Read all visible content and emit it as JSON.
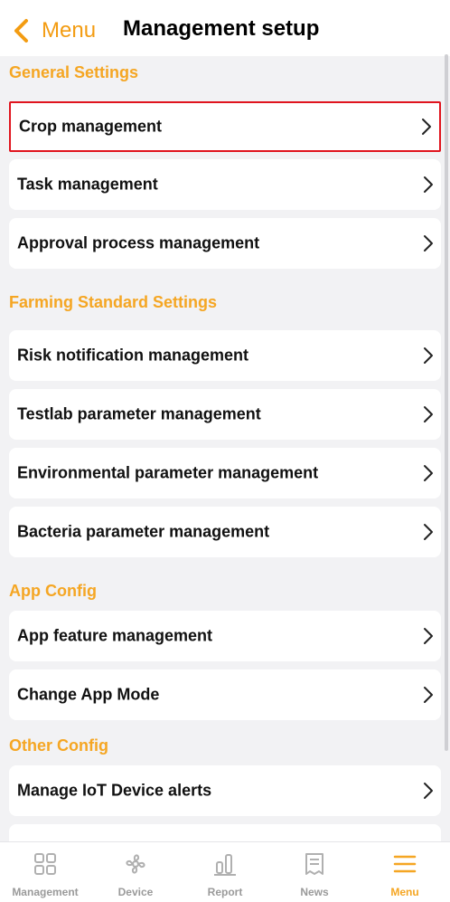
{
  "header": {
    "back_label": "Menu",
    "title": "Management setup"
  },
  "sections": {
    "general": "General Settings",
    "farming": "Farming Standard Settings",
    "app": "App Config",
    "other": "Other Config"
  },
  "items": {
    "crop": "Crop management",
    "task": "Task management",
    "approval": "Approval process management",
    "risk": "Risk notification management",
    "testlab": "Testlab parameter management",
    "environmental": "Environmental parameter management",
    "bacteria": "Bacteria parameter management",
    "app_feature": "App feature management",
    "app_mode": "Change App Mode",
    "iot_alerts": "Manage IoT Device alerts"
  },
  "tabs": {
    "management": "Management",
    "device": "Device",
    "report": "Report",
    "news": "News",
    "menu": "Menu",
    "active": "menu"
  },
  "colors": {
    "accent": "#f5a623",
    "highlight_border": "#e0141e",
    "background": "#f2f2f4"
  }
}
